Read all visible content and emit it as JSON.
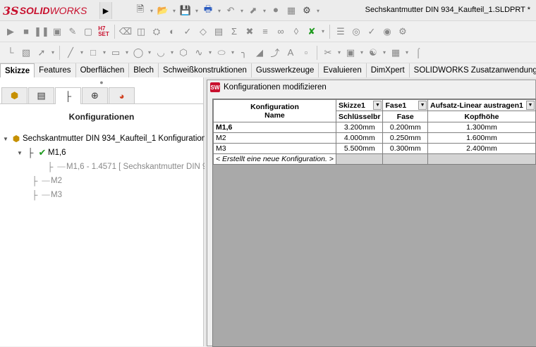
{
  "app": {
    "logo_ds": "3S",
    "logo_solid": "SOLID",
    "logo_works": "WORKS",
    "document_title": "Sechskantmutter DIN 934_Kaufteil_1.SLDPRT *"
  },
  "colors": {
    "brand_red": "#c8102e",
    "check_green": "#1e9a1e",
    "grid_background": "#a9a9a9"
  },
  "command_tabs": [
    "Skizze",
    "Features",
    "Oberflächen",
    "Blech",
    "Schweißkonstruktionen",
    "Gusswerkzeuge",
    "Evaluieren",
    "DimXpert",
    "SOLIDWORKS Zusatzanwendungen"
  ],
  "active_command_tab": "Skizze",
  "left_panel": {
    "title": "Konfigurationen",
    "panel_tab_icons": [
      "feature-manager-icon",
      "property-manager-icon",
      "configuration-manager-icon",
      "dimxpert-icon",
      "display-manager-icon"
    ],
    "tree": {
      "root": "Sechskantmutter DIN 934_Kaufteil_1 Konfiguration",
      "active_config": "M1,6",
      "active_child": "M1,6 - 1.4571 [ Sechskantmutter DIN 9",
      "config_2": "M2",
      "config_3": "M3"
    }
  },
  "dialog": {
    "title": "Konfigurationen modifizieren",
    "icon_text": "SW",
    "table": {
      "header_config": "Konfiguration",
      "header_name": "Name",
      "columns": [
        {
          "feature": "Skizze1",
          "param": "Schlüsselbr"
        },
        {
          "feature": "Fase1",
          "param": "Fase"
        },
        {
          "feature": "Aufsatz-Linear austragen1",
          "param": "Kopfhöhe"
        }
      ],
      "rows": [
        {
          "name": "M1,6",
          "values": [
            "3.200mm",
            "0.200mm",
            "1.300mm"
          ]
        },
        {
          "name": "M2",
          "values": [
            "4.000mm",
            "0.250mm",
            "1.600mm"
          ]
        },
        {
          "name": "M3",
          "values": [
            "5.500mm",
            "0.300mm",
            "2.400mm"
          ]
        }
      ],
      "new_config_label": "< Erstellt eine neue Konfiguration. >"
    }
  }
}
